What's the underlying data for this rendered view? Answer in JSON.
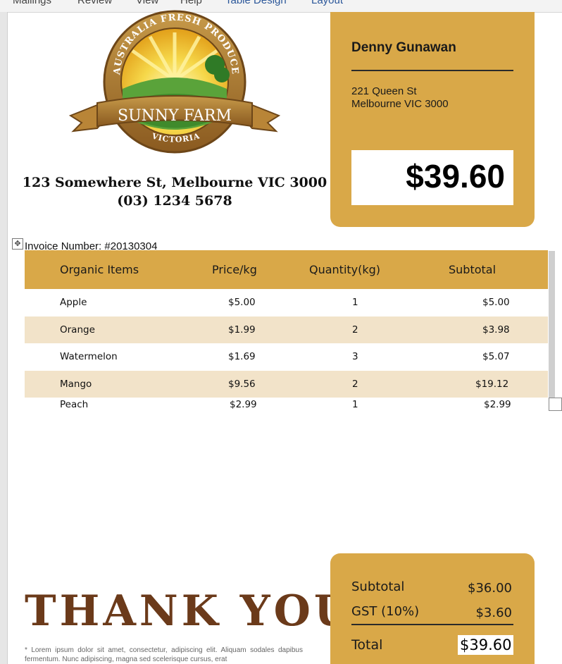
{
  "ribbon": {
    "tabs": [
      "Mailings",
      "Review",
      "View",
      "Help",
      "Table Design",
      "Layout"
    ]
  },
  "company": {
    "logo": {
      "arc_top": "AUSTRALIA FRESH PRODUCE",
      "banner": "SUNNY FARM",
      "arc_bottom": "VICTORIA"
    },
    "address": "123 Somewhere St, Melbourne VIC 3000",
    "phone": "(03) 1234 5678"
  },
  "customer": {
    "name": "Denny Gunawan",
    "street": "221 Queen St",
    "city": "Melbourne VIC 3000",
    "amount_due": "$39.60"
  },
  "invoice": {
    "number_label": "Invoice Number: #20130304",
    "columns": [
      "Organic Items",
      "Price/kg",
      "Quantity(kg)",
      "Subtotal"
    ],
    "rows": [
      {
        "item": "Apple",
        "price": "$5.00",
        "qty": "1",
        "subtotal": "$5.00"
      },
      {
        "item": "Orange",
        "price": "$1.99",
        "qty": "2",
        "subtotal": "$3.98"
      },
      {
        "item": "Watermelon",
        "price": "$1.69",
        "qty": "3",
        "subtotal": "$5.07"
      },
      {
        "item": "Mango",
        "price": "$9.56",
        "qty": "2",
        "subtotal": "$19.12"
      },
      {
        "item": "Peach",
        "price": "$2.99",
        "qty": "1",
        "subtotal": "$2.99"
      }
    ]
  },
  "footer": {
    "thank_you": "THANK YOU",
    "lorem": "* Lorem ipsum dolor sit amet, consectetur, adipiscing elit. Aliquam sodales dapibus fermentum. Nunc adipiscing, magna sed scelerisque cursus, erat"
  },
  "totals": {
    "subtotal_label": "Subtotal",
    "subtotal_value": "$36.00",
    "gst_label": "GST (10%)",
    "gst_value": "$3.60",
    "total_label": "Total",
    "total_value": "$39.60"
  },
  "colors": {
    "accent": "#d9a848",
    "row_shade": "#f2e3c9",
    "thank_you": "#6b3a1a"
  }
}
